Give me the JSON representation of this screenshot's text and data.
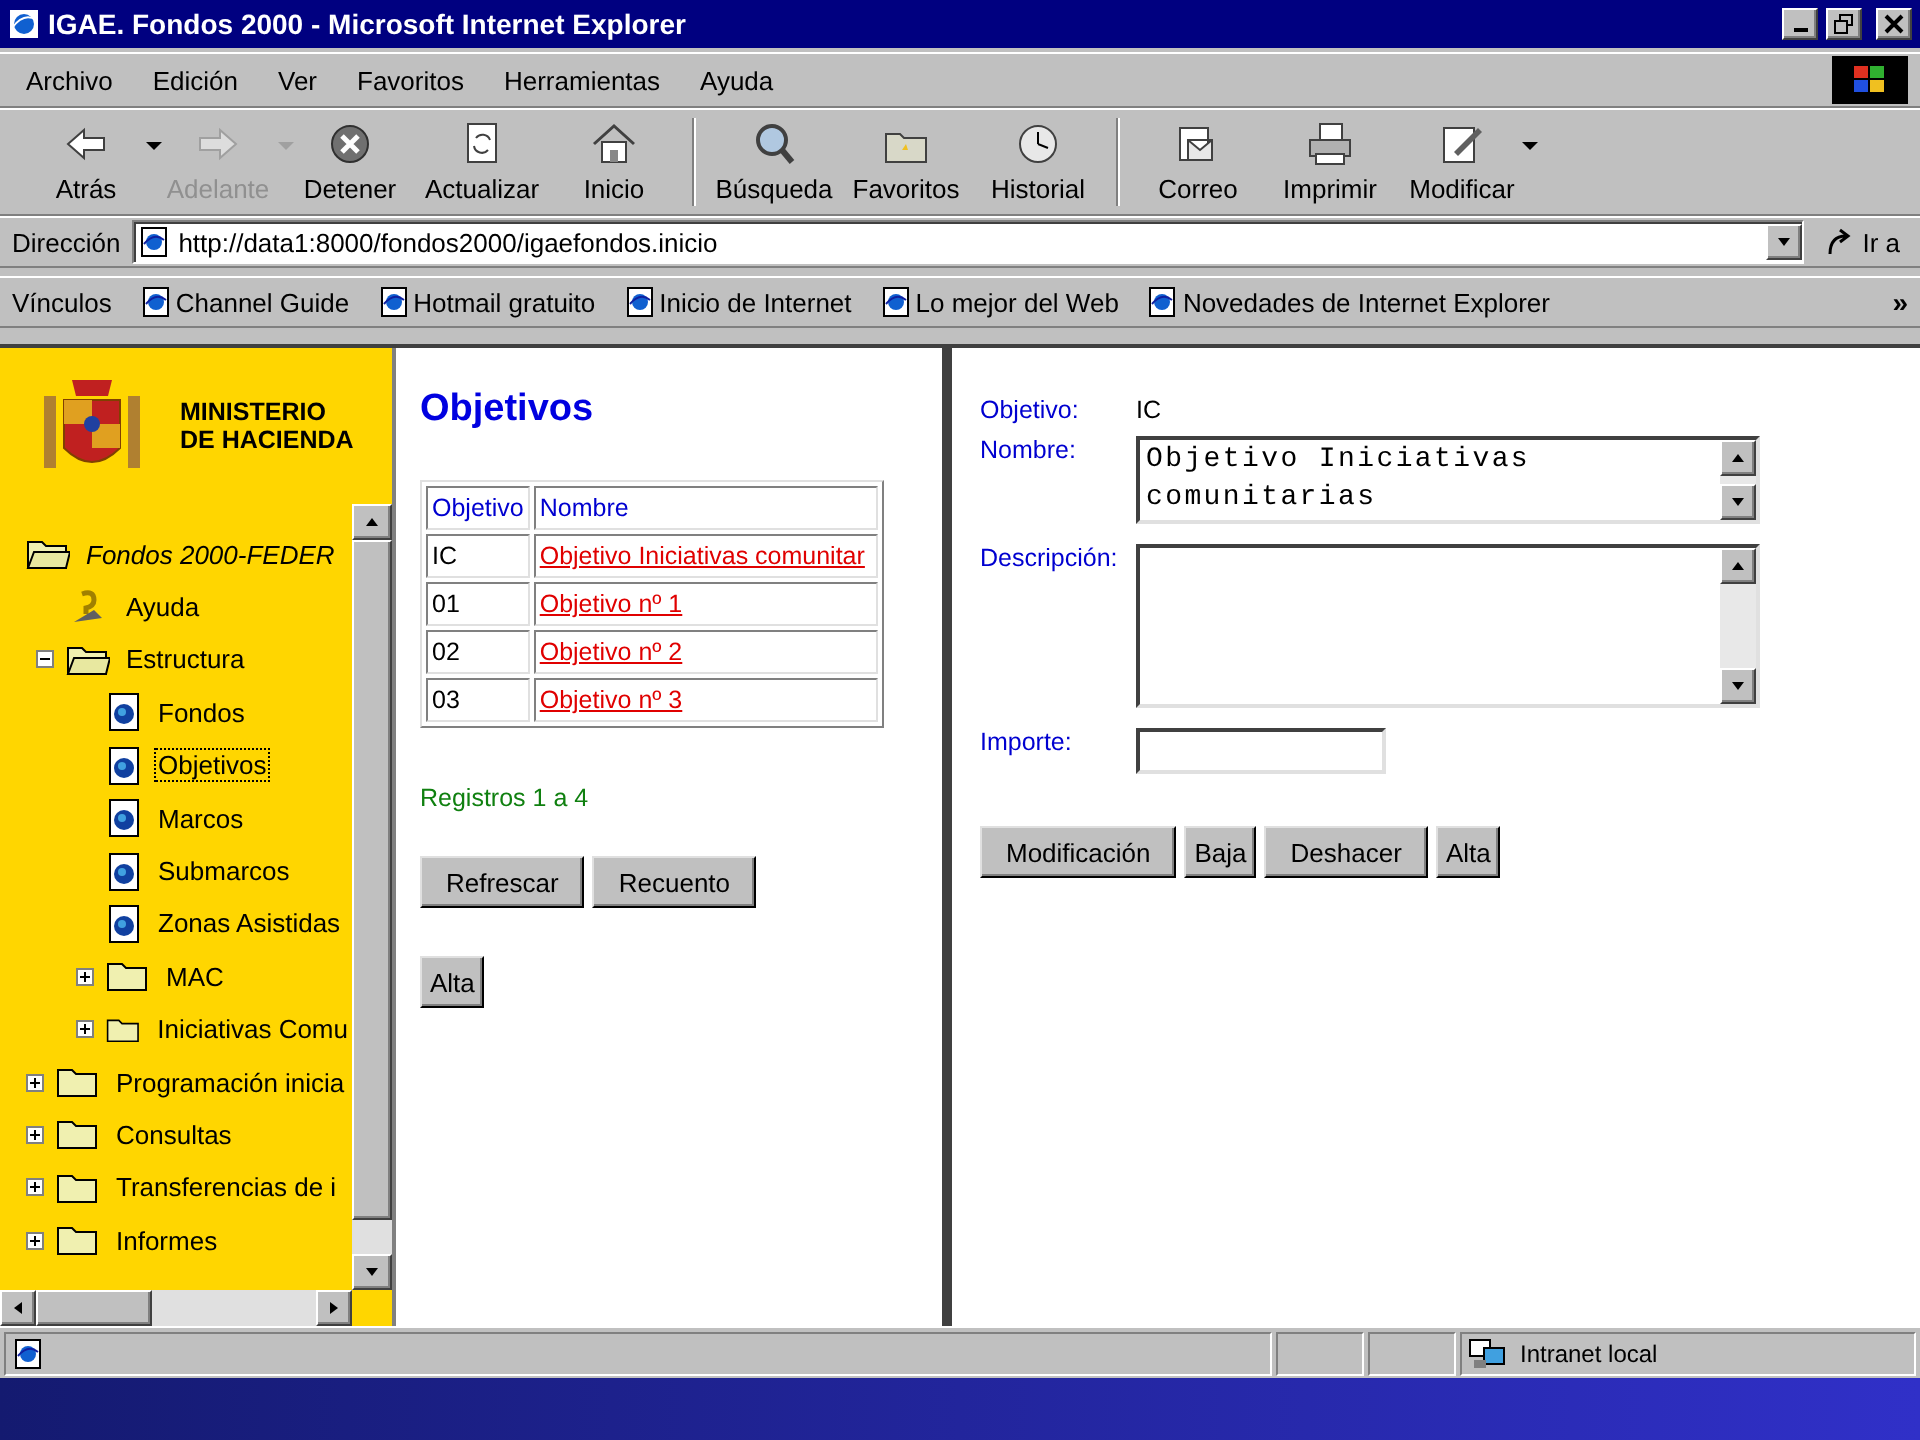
{
  "window": {
    "title": "IGAE. Fondos 2000 - Microsoft Internet Explorer"
  },
  "menu": [
    "Archivo",
    "Edición",
    "Ver",
    "Favoritos",
    "Herramientas",
    "Ayuda"
  ],
  "toolbar": [
    {
      "label": "Atrás",
      "kind": "back",
      "disabled": false,
      "dropdown": true
    },
    {
      "label": "Adelante",
      "kind": "forward",
      "disabled": true,
      "dropdown": true
    },
    {
      "label": "Detener",
      "kind": "stop",
      "disabled": false,
      "dropdown": false
    },
    {
      "label": "Actualizar",
      "kind": "refresh",
      "disabled": false,
      "dropdown": false
    },
    {
      "label": "Inicio",
      "kind": "home",
      "disabled": false,
      "dropdown": false,
      "group_end": true
    },
    {
      "label": "Búsqueda",
      "kind": "search",
      "disabled": false,
      "dropdown": false
    },
    {
      "label": "Favoritos",
      "kind": "favorites",
      "disabled": false,
      "dropdown": false
    },
    {
      "label": "Historial",
      "kind": "history",
      "disabled": false,
      "dropdown": false,
      "group_end": true
    },
    {
      "label": "Correo",
      "kind": "mail",
      "disabled": false,
      "dropdown": false
    },
    {
      "label": "Imprimir",
      "kind": "print",
      "disabled": false,
      "dropdown": false
    },
    {
      "label": "Modificar",
      "kind": "edit",
      "disabled": false,
      "dropdown": true
    }
  ],
  "address": {
    "label": "Dirección",
    "value": "http://data1:8000/fondos2000/igaefondos.inicio",
    "go": "Ir a"
  },
  "links": {
    "label": "Vínculos",
    "items": [
      "Channel Guide",
      "Hotmail gratuito",
      "Inicio de Internet",
      "Lo mejor del Web",
      "Novedades de Internet Explorer"
    ],
    "more": "»"
  },
  "sidebar": {
    "logo": [
      "MINISTERIO",
      "DE HACIENDA"
    ],
    "tree": [
      {
        "label": "Fondos 2000-FEDER",
        "kind": "folder",
        "selected": false,
        "children": [
          {
            "label": "Ayuda",
            "kind": "help",
            "selected": false
          },
          {
            "label": "Estructura",
            "kind": "folder",
            "selected": false,
            "expanded": true,
            "children": [
              {
                "label": "Fondos",
                "kind": "page",
                "selected": false
              },
              {
                "label": "Objetivos",
                "kind": "page",
                "selected": true
              },
              {
                "label": "Marcos",
                "kind": "page",
                "selected": false
              },
              {
                "label": "Submarcos",
                "kind": "page",
                "selected": false
              },
              {
                "label": "Zonas Asistidas",
                "kind": "page",
                "selected": false
              },
              {
                "label": "MAC",
                "kind": "folder",
                "selected": false,
                "expanded": false
              },
              {
                "label": "Iniciativas Comu",
                "kind": "folder",
                "selected": false,
                "expanded": false
              }
            ]
          }
        ]
      },
      {
        "label": "Programación inicia",
        "kind": "folder",
        "selected": false,
        "expanded": false
      },
      {
        "label": "Consultas",
        "kind": "folder",
        "selected": false,
        "expanded": false
      },
      {
        "label": "Transferencias de i",
        "kind": "folder",
        "selected": false,
        "expanded": false
      },
      {
        "label": "Informes",
        "kind": "folder",
        "selected": false,
        "expanded": false
      }
    ]
  },
  "list": {
    "title": "Objetivos",
    "columns": [
      "Objetivo",
      "Nombre"
    ],
    "rows": [
      {
        "code": "IC",
        "name": "Objetivo Iniciativas comunitar"
      },
      {
        "code": "01",
        "name": "Objetivo nº 1"
      },
      {
        "code": "02",
        "name": "Objetivo nº 2"
      },
      {
        "code": "03",
        "name": "Objetivo nº 3"
      }
    ],
    "records": "Registros 1 a 4",
    "buttons": [
      "Refrescar",
      "Recuento"
    ],
    "add_button": "Alta"
  },
  "detail": {
    "fields": [
      {
        "label": "Objetivo:",
        "kind": "text",
        "value": "IC"
      },
      {
        "label": "Nombre:",
        "kind": "textarea",
        "value": "Objetivo Iniciativas comunitarias"
      },
      {
        "label": "Descripción:",
        "kind": "textarea_tall"
      },
      {
        "label": "Importe:",
        "kind": "input"
      }
    ],
    "buttons": [
      "Modificación",
      "Baja",
      "Deshacer",
      "Alta"
    ]
  },
  "status_bar": {
    "zone": "Intranet local"
  }
}
